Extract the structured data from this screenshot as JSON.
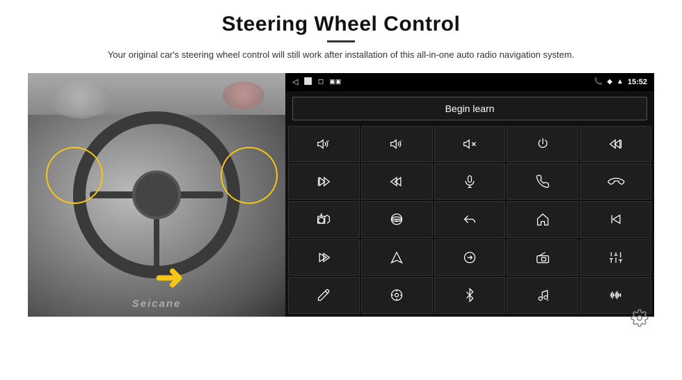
{
  "header": {
    "title": "Steering Wheel Control",
    "subtitle": "Your original car's steering wheel control will still work after installation of this all-in-one auto radio navigation system."
  },
  "status_bar": {
    "time": "15:52",
    "nav_back": "◁",
    "nav_home": "⬜",
    "nav_recent": "◻"
  },
  "begin_learn": {
    "label": "Begin learn"
  },
  "grid_icons": [
    {
      "id": "vol-up",
      "symbol": "🔊+"
    },
    {
      "id": "vol-down",
      "symbol": "🔊−"
    },
    {
      "id": "mute",
      "symbol": "🔇"
    },
    {
      "id": "power",
      "symbol": "⏻"
    },
    {
      "id": "prev-track",
      "symbol": "⏮"
    },
    {
      "id": "next-row1",
      "symbol": "⏭"
    },
    {
      "id": "seek-prev",
      "symbol": "⏪"
    },
    {
      "id": "mic",
      "symbol": "🎤"
    },
    {
      "id": "phone",
      "symbol": "📞"
    },
    {
      "id": "hang-up",
      "symbol": "📵"
    },
    {
      "id": "camera",
      "symbol": "📷"
    },
    {
      "id": "360-view",
      "symbol": "👁"
    },
    {
      "id": "back-nav",
      "symbol": "↩"
    },
    {
      "id": "home-nav",
      "symbol": "🏠"
    },
    {
      "id": "skip-back",
      "symbol": "⏮"
    },
    {
      "id": "fast-fwd",
      "symbol": "⏭"
    },
    {
      "id": "compass",
      "symbol": "▶"
    },
    {
      "id": "exchange",
      "symbol": "⇄"
    },
    {
      "id": "radio",
      "symbol": "📻"
    },
    {
      "id": "eq",
      "symbol": "🎚"
    },
    {
      "id": "pen",
      "symbol": "✏"
    },
    {
      "id": "settings-circle",
      "symbol": "⚙"
    },
    {
      "id": "bluetooth",
      "symbol": "⚡"
    },
    {
      "id": "music",
      "symbol": "🎵"
    },
    {
      "id": "waveform",
      "symbol": "📶"
    }
  ],
  "seicane": {
    "label": "Seicane"
  },
  "bottom": {
    "gear_label": "⚙"
  }
}
